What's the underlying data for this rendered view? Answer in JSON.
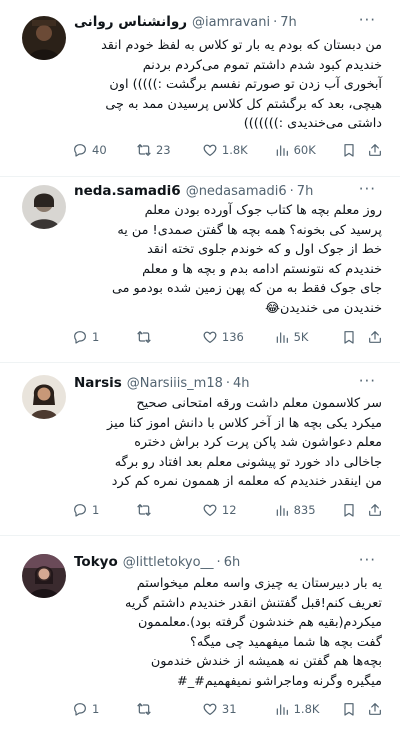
{
  "tweets": [
    {
      "name": "روانشناس روانی",
      "handle": "@iamravani",
      "dot": "·",
      "time": "7h",
      "text": "من دبستان که بودم یه بار تو کلاس به لفظ خودم انقد\nخندیدم کبود شدم داشتم تموم می‌کردم بردنم\nآبخوری آب زدن تو صورتم نفسم برگشت :))))) اون\nهیچی، بعد که برگشتم کل کلاس پرسیدن ممد به چی\nداشتی می‌خندیدی :)))))))",
      "stats": {
        "replies": "40",
        "retweets": "23",
        "likes": "1.8K",
        "views": "60K"
      }
    },
    {
      "name": "neda.samadi6",
      "handle": "@nedasamadi6",
      "dot": "·",
      "time": "7h",
      "text": "روز معلم بچه ها کتاب جوک آورده بودن معلم\nپرسید کی بخونه؟ همه بچه ها گفتن صمدی! من یه\nخط از جوک اول و که خوندم جلوی تخته انقد\nخندیدم که نتونستم ادامه بدم و بچه ها و معلم\nجای جوک فقط به من که پهن زمین شده بودمو می\nخندیدن می خندیدن😂",
      "stats": {
        "replies": "1",
        "retweets": "",
        "likes": "136",
        "views": "5K"
      }
    },
    {
      "name": "Narsis",
      "handle": "@Narsiiis_m18",
      "dot": "·",
      "time": "4h",
      "text": "سر کلاسمون معلم داشت ورقه امتحانی صحیح\nمیکرد یکی بچه ها از آخر کلاس با دانش اموز کنا میز\nمعلم دعواشون شد پاکن پرت کرد براش دختره\nجاخالی داد خورد تو پیشونی معلم بعد افتاد رو برگه\nمن اینقدر خندیدم که معلمه از هممون نمره کم کرد",
      "stats": {
        "replies": "1",
        "retweets": "",
        "likes": "12",
        "views": "835"
      }
    },
    {
      "name": "Tokyo",
      "handle": "@littletokyo__",
      "dot": "·",
      "time": "6h",
      "text": "یه بار دبیرستان یه چیزی واسه معلم میخواستم\nتعریف کنم!قبل گفتنش انقدر خندیدم داشتم گریه\nمیکردم(بقیه هم خندشون گرفته بود).معلممون\nگفت بچه ها شما میفهمید چی میگه؟\nبچه‌ها هم گفتن نه همیشه از خندش خندمون\nمیگیره وگرنه وماجراشو نمیفهمیم#_#",
      "stats": {
        "replies": "1",
        "retweets": "",
        "likes": "31",
        "views": "1.8K"
      }
    }
  ],
  "more_glyph": "···",
  "colors": {
    "text": "#0f1419",
    "muted": "#536471",
    "divider": "#eff3f4"
  }
}
